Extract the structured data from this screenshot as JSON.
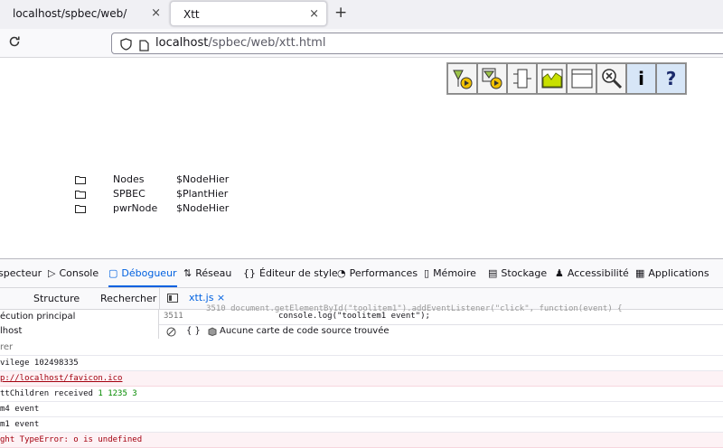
{
  "browser": {
    "tabs": [
      {
        "title": "localhost/spbec/web/",
        "close": "×"
      },
      {
        "title": "Xtt",
        "close": "×"
      }
    ],
    "new_tab": "+",
    "reload_icon": "reload-icon",
    "url_host": "localhost",
    "url_path": "/spbec/web/xtt.html"
  },
  "toolbar": {
    "buttons": [
      {
        "icon": "open-object-icon"
      },
      {
        "icon": "open-trace-icon"
      },
      {
        "icon": "open-plc-icon"
      },
      {
        "icon": "trend-icon"
      },
      {
        "icon": "graph-icon"
      },
      {
        "icon": "zoom-reset-icon"
      },
      {
        "icon": "info-icon",
        "glyph": "i"
      },
      {
        "icon": "help-icon",
        "glyph": "?"
      }
    ]
  },
  "tree": [
    {
      "name": "Nodes",
      "class": "$NodeHier"
    },
    {
      "name": "SPBEC",
      "class": "$PlantHier"
    },
    {
      "name": "pwrNode",
      "class": "$NodeHier"
    }
  ],
  "devtools": {
    "tabs": [
      {
        "label": "specteur",
        "icon": ""
      },
      {
        "label": "Console",
        "icon": "▷"
      },
      {
        "label": "Débogueur",
        "icon": "▢"
      },
      {
        "label": "Réseau",
        "icon": "⇅"
      },
      {
        "label": "Éditeur de style",
        "icon": "{}"
      },
      {
        "label": "Performances",
        "icon": "◔"
      },
      {
        "label": "Mémoire",
        "icon": "▯"
      },
      {
        "label": "Stockage",
        "icon": "▤"
      },
      {
        "label": "Accessibilité",
        "icon": "♟"
      },
      {
        "label": "Applications",
        "icon": "▦"
      }
    ],
    "sub_structure": "Structure",
    "sub_search": "Rechercher",
    "source_tab": "xtt.js",
    "source_close": "×",
    "left_rows": [
      "écution principal",
      "lhost"
    ],
    "code_ghost": "3510      document.getElementById(\"toolitem1\").addEventListener(\"click\", function(event) {",
    "code_line_number": "3511",
    "code_line": "console.log(\"toolitem1 event\");",
    "source_map_braces": "{ }",
    "source_map_text": "Aucune carte de code source trouvée",
    "filter_placeholder": "rer",
    "console_rows": [
      {
        "type": "log",
        "text": "vilege 102498335"
      },
      {
        "type": "err",
        "text": "p://localhost/favicon.ico",
        "link": true
      },
      {
        "type": "log",
        "text": "ttChildren received ",
        "num": "1 1235 3"
      },
      {
        "type": "log",
        "text": "m4 event"
      },
      {
        "type": "log",
        "text": "m1 event"
      },
      {
        "type": "err",
        "text": "ght TypeError: o is undefined"
      }
    ]
  }
}
